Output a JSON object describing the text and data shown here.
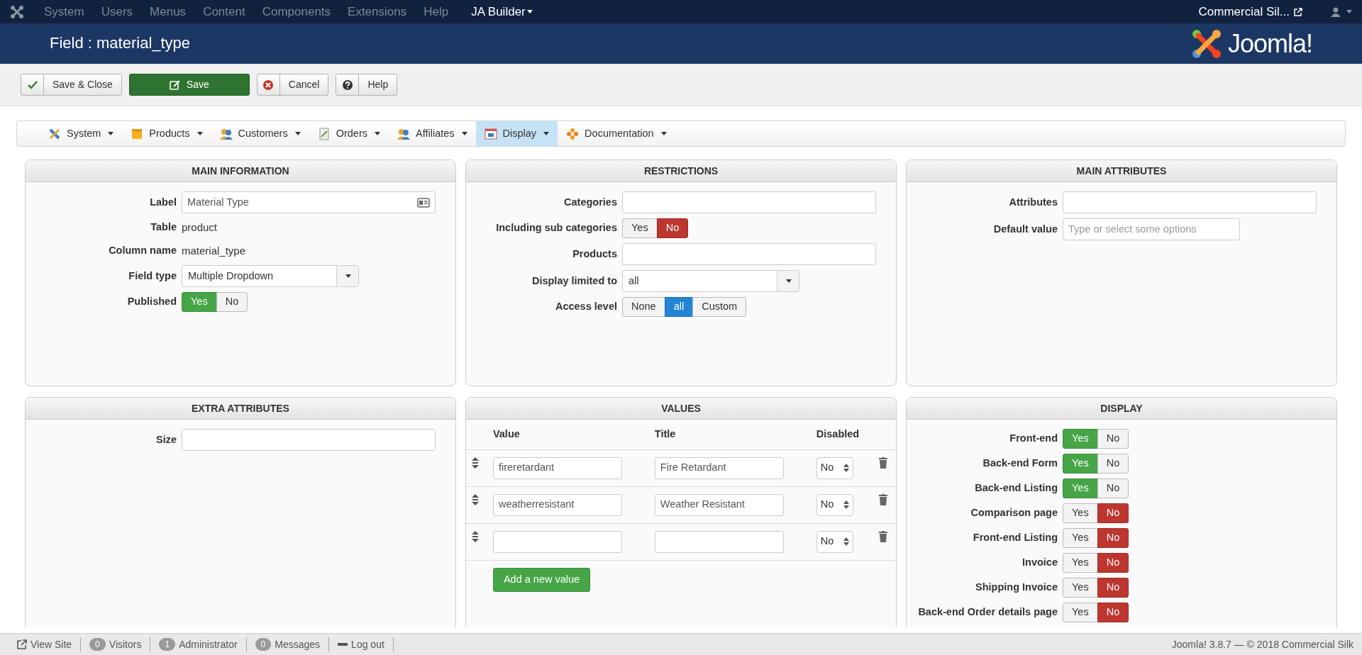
{
  "top_menu": {
    "items": [
      "System",
      "Users",
      "Menus",
      "Content",
      "Components",
      "Extensions",
      "Help"
    ],
    "builder": "JA Builder",
    "site": "Commercial Sil..."
  },
  "header": {
    "title": "Field : material_type",
    "brand": "Joomla!"
  },
  "toolbar": [
    {
      "label": "Save & Close",
      "kind": "check"
    },
    {
      "label": "Save",
      "kind": "save"
    },
    {
      "label": "Cancel",
      "kind": "cancel"
    },
    {
      "label": "Help",
      "kind": "help"
    }
  ],
  "submenu": [
    {
      "label": "System",
      "selected": false
    },
    {
      "label": "Products",
      "selected": false
    },
    {
      "label": "Customers",
      "selected": false
    },
    {
      "label": "Orders",
      "selected": false
    },
    {
      "label": "Affiliates",
      "selected": false
    },
    {
      "label": "Display",
      "selected": true
    },
    {
      "label": "Documentation",
      "selected": false
    }
  ],
  "panels": [
    {
      "title": "MAIN INFORMATION",
      "kind": "form",
      "fields": [
        {
          "label": "Label",
          "kind": "input",
          "value": "Material Type",
          "card_icon": true
        },
        {
          "label": "Table",
          "kind": "text",
          "value": "product"
        },
        {
          "label": "Column name",
          "kind": "text",
          "value": "material_type"
        },
        {
          "label": "Field type",
          "kind": "select",
          "value": "Multiple Dropdown"
        },
        {
          "label": "Published",
          "kind": "yesno",
          "options": [
            {
              "label": "Yes",
              "selected": true
            },
            {
              "label": "No",
              "selected": false
            }
          ]
        }
      ]
    },
    {
      "title": "RESTRICTIONS",
      "kind": "form",
      "fields": [
        {
          "label": "Categories",
          "kind": "input"
        },
        {
          "label": "Including sub categories",
          "kind": "yesno",
          "options": [
            {
              "label": "Yes",
              "selected": false
            },
            {
              "label": "No",
              "selected": true
            }
          ]
        },
        {
          "label": "Products",
          "kind": "input"
        },
        {
          "label": "Display limited to",
          "kind": "select",
          "value": "all"
        },
        {
          "label": "Access level",
          "kind": "choice",
          "options": [
            {
              "label": "None",
              "selected": false
            },
            {
              "label": "all",
              "selected": true
            },
            {
              "label": "Custom",
              "selected": false
            }
          ]
        }
      ]
    },
    {
      "title": "MAIN ATTRIBUTES",
      "kind": "form",
      "fields": [
        {
          "label": "Attributes",
          "kind": "input"
        },
        {
          "label": "Default value",
          "kind": "input",
          "placeholder": "Type or select some options",
          "short": true
        }
      ]
    },
    {
      "title": "EXTRA ATTRIBUTES",
      "kind": "form",
      "fields": [
        {
          "label": "Size",
          "kind": "input"
        }
      ]
    },
    {
      "title": "VALUES",
      "kind": "values",
      "columns": [
        "Value",
        "Title",
        "Disabled"
      ],
      "rows": [
        {
          "value": "fireretardant",
          "title": "Fire Retardant",
          "disabled": "No"
        },
        {
          "value": "weatherresistant",
          "title": "Weather Resistant",
          "disabled": "No"
        },
        {
          "disabled": "No"
        }
      ],
      "add_button": "Add a new value"
    },
    {
      "title": "DISPLAY",
      "kind": "form",
      "fields": [
        {
          "label": "Front-end",
          "kind": "yesno",
          "options": [
            {
              "label": "Yes",
              "selected": true
            },
            {
              "label": "No",
              "selected": false
            }
          ]
        },
        {
          "label": "Back-end Form",
          "kind": "yesno",
          "options": [
            {
              "label": "Yes",
              "selected": true
            },
            {
              "label": "No",
              "selected": false
            }
          ]
        },
        {
          "label": "Back-end Listing",
          "kind": "yesno",
          "options": [
            {
              "label": "Yes",
              "selected": true
            },
            {
              "label": "No",
              "selected": false
            }
          ]
        },
        {
          "label": "Comparison page",
          "kind": "yesno",
          "options": [
            {
              "label": "Yes",
              "selected": false
            },
            {
              "label": "No",
              "selected": true
            }
          ]
        },
        {
          "label": "Front-end Listing",
          "kind": "yesno",
          "options": [
            {
              "label": "Yes",
              "selected": false
            },
            {
              "label": "No",
              "selected": true
            }
          ]
        },
        {
          "label": "Invoice",
          "kind": "yesno",
          "options": [
            {
              "label": "Yes",
              "selected": false
            },
            {
              "label": "No",
              "selected": true
            }
          ]
        },
        {
          "label": "Shipping Invoice",
          "kind": "yesno",
          "options": [
            {
              "label": "Yes",
              "selected": false
            },
            {
              "label": "No",
              "selected": true
            }
          ]
        },
        {
          "label": "Back-end Order details page",
          "kind": "yesno",
          "options": [
            {
              "label": "Yes",
              "selected": false
            },
            {
              "label": "No",
              "selected": true
            }
          ]
        }
      ]
    }
  ],
  "status_bar": {
    "left": [
      {
        "kind": "link",
        "label": "View Site"
      },
      {
        "kind": "count",
        "count": "0",
        "label": "Visitors"
      },
      {
        "kind": "count",
        "count": "1",
        "label": "Administrator"
      },
      {
        "kind": "count",
        "count": "0",
        "label": "Messages"
      },
      {
        "kind": "logout",
        "label": "Log out"
      }
    ],
    "right": "Joomla! 3.8.7  —  © 2018 Commercial Silk"
  }
}
